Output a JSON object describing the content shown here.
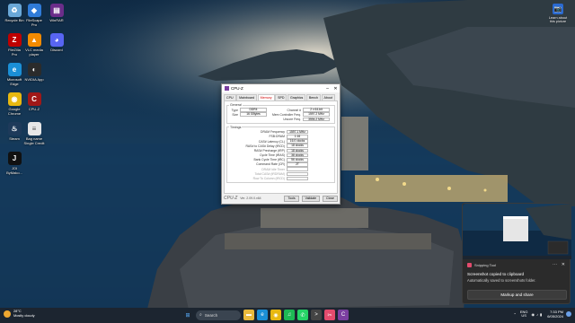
{
  "desktop": {
    "icons_left": [
      {
        "label": "Recycle Bin",
        "icon": "recycle-bin-icon",
        "color": "#6aa8d8",
        "glyph": "♻"
      },
      {
        "label": "FileZilla\nPro",
        "icon": "filezilla-icon",
        "color": "#bf0000",
        "glyph": "Z"
      },
      {
        "label": "Microsoft\nEdge",
        "icon": "edge-icon",
        "color": "#1b8fd6",
        "glyph": "e"
      },
      {
        "label": "Google\nChrome",
        "icon": "chrome-icon",
        "color": "#e8b810",
        "glyph": "◉"
      },
      {
        "label": "Steam",
        "icon": "steam-icon",
        "color": "#1e3a5a",
        "glyph": "♨"
      },
      {
        "label": "JOI\nByMako...",
        "icon": "joi-icon",
        "color": "#111111",
        "glyph": "J"
      }
    ],
    "icons_mid": [
      {
        "label": "FileScape\nPro",
        "icon": "filescape-icon",
        "color": "#2f7bd8",
        "glyph": "◆"
      },
      {
        "label": "VLC media\nplayer",
        "icon": "vlc-icon",
        "color": "#f28a00",
        "glyph": "▲"
      },
      {
        "label": "NVIDIA App",
        "icon": "nvidia-icon",
        "color": "#2b2b2b",
        "glyph": "◐"
      },
      {
        "label": "CPU-Z",
        "icon": "cpuz-icon",
        "color": "#a01818",
        "glyph": "C"
      },
      {
        "label": "Bag name\nSingle Credit",
        "icon": "document-icon",
        "color": "#e7e7e7",
        "glyph": "≡"
      }
    ],
    "icons_third": [
      {
        "label": "WinRAR",
        "icon": "winrar-icon",
        "color": "#6b2d8a",
        "glyph": "▤"
      },
      {
        "label": "Discord",
        "icon": "discord-icon",
        "color": "#5865f2",
        "glyph": "◕"
      }
    ],
    "learn": {
      "label": "Learn about\nthis picture",
      "icon": "learn-picture-icon"
    }
  },
  "cpuz": {
    "title": "CPU-Z",
    "tabs": [
      "CPU",
      "Mainboard",
      "Memory",
      "SPD",
      "Graphics",
      "Bench",
      "About"
    ],
    "active_tab": "Memory",
    "general_legend": "General",
    "general": {
      "type_label": "Type",
      "type_value": "DDR4",
      "size_label": "Size",
      "size_value": "16 GBytes",
      "channel_label": "Channel #",
      "channel_value": "2 x 64-bit",
      "mem_ctrl_label": "Mem Controller Freq.",
      "mem_ctrl_value": "1597.2 MHz",
      "uncore_label": "Uncore Freq.",
      "uncore_value": "3594.2 MHz"
    },
    "timings_legend": "Timings",
    "timings": [
      {
        "label": "DRAM Frequency",
        "value": "1597.1 MHz",
        "dim": false
      },
      {
        "label": "FSB:DRAM",
        "value": "1:16",
        "dim": false
      },
      {
        "label": "CAS# Latency (CL)",
        "value": "16.0 clocks",
        "dim": false
      },
      {
        "label": "RAS# to CAS# Delay (tRCD)",
        "value": "18 clocks",
        "dim": false
      },
      {
        "label": "RAS# Precharge (tRP)",
        "value": "18 clocks",
        "dim": false
      },
      {
        "label": "Cycle Time (tRAS)",
        "value": "38 clocks",
        "dim": false
      },
      {
        "label": "Bank Cycle Time (tRC)",
        "value": "56 clocks",
        "dim": false
      },
      {
        "label": "Command Rate (CR)",
        "value": "2T",
        "dim": false
      },
      {
        "label": "DRAM Idle Timer",
        "value": "",
        "dim": true
      },
      {
        "label": "Total CAS# (tRDRAM)",
        "value": "",
        "dim": true
      },
      {
        "label": "Row To Column (tRCD)",
        "value": "",
        "dim": true
      }
    ],
    "brand": "CPU-Z",
    "version": "Ver. 2.09.0.x64",
    "tools_label": "Tools",
    "validate_label": "Validate",
    "close_label": "Close"
  },
  "notification": {
    "app": "Snipping Tool",
    "title": "Screenshot copied to clipboard",
    "body": "Automatically saved to screenshots folder.",
    "action": "Markup and share",
    "more_glyph": "···",
    "close_glyph": "✕"
  },
  "taskbar": {
    "weather_temp": "28°C",
    "weather_desc": "Mostly cloudy",
    "search_placeholder": "Search",
    "lang_line1": "ENG",
    "lang_line2": "US",
    "time": "7:33 PM",
    "date": "6/05/2024",
    "apps": [
      {
        "icon": "file-explorer-icon",
        "color": "#e8b93c",
        "glyph": "▬"
      },
      {
        "icon": "edge-icon",
        "color": "#1b8fd6",
        "glyph": "e"
      },
      {
        "icon": "chrome-icon",
        "color": "#e8b810",
        "glyph": "◉"
      },
      {
        "icon": "spotify-icon",
        "color": "#1db954",
        "glyph": "♫"
      },
      {
        "icon": "whatsapp-icon",
        "color": "#25d366",
        "glyph": "✆"
      },
      {
        "icon": "terminal-icon",
        "color": "#444444",
        "glyph": ">"
      },
      {
        "icon": "snipping-tool-icon",
        "color": "#e34b6d",
        "glyph": "✂"
      },
      {
        "icon": "cpuz-icon",
        "color": "#7b3fa0",
        "glyph": "C"
      }
    ]
  }
}
